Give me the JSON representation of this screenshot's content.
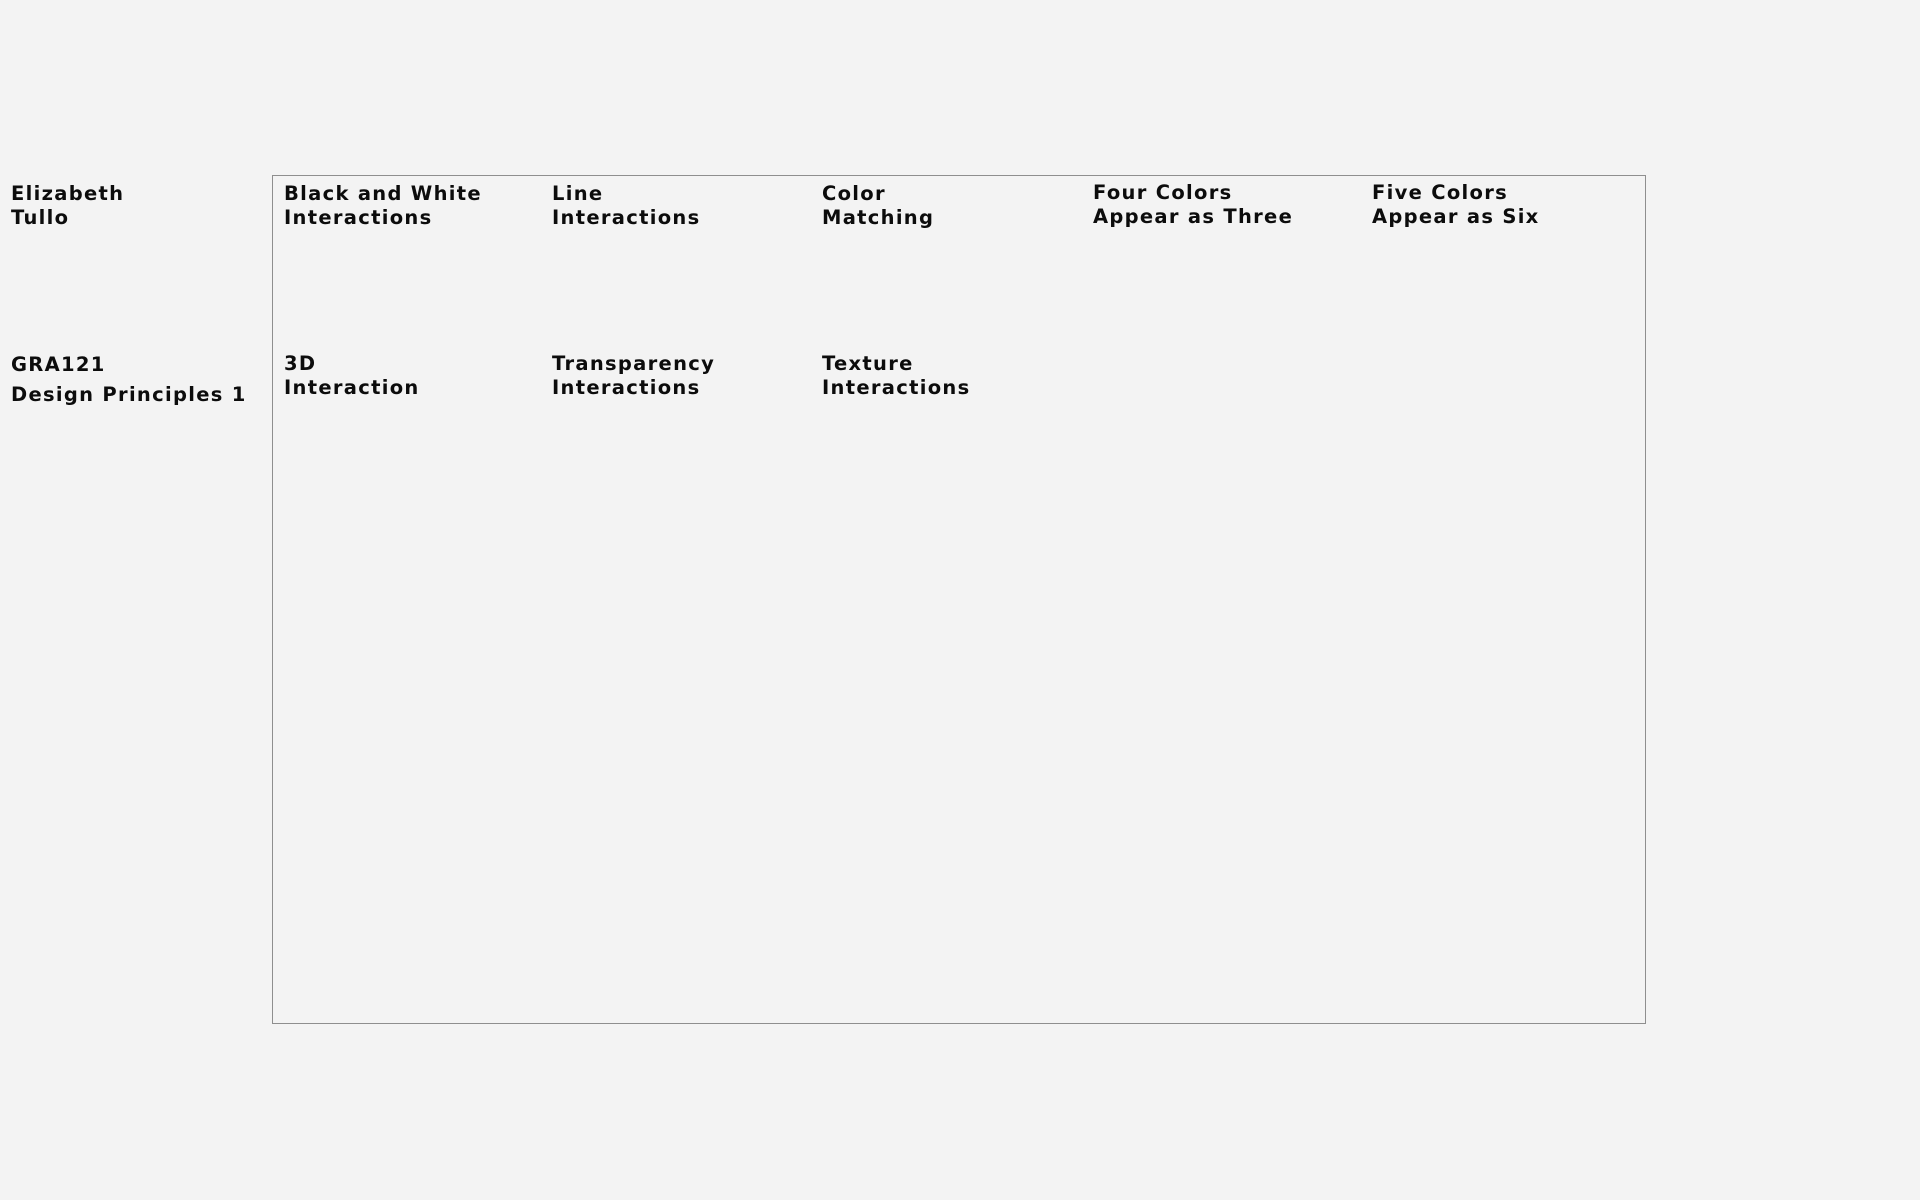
{
  "author": {
    "first_name": "Elizabeth",
    "last_name": "Tullo"
  },
  "course": {
    "code": "GRA121",
    "name": "Design Principles 1"
  },
  "projects": [
    {
      "line1": "Black and White",
      "line2": "Interactions"
    },
    {
      "line1": "Line",
      "line2": "Interactions"
    },
    {
      "line1": "Color",
      "line2": "Matching"
    },
    {
      "line1": "Four Colors",
      "line2": "Appear as Three"
    },
    {
      "line1": "Five Colors",
      "line2": "Appear as Six"
    },
    {
      "line1": "3D",
      "line2": "Interaction"
    },
    {
      "line1": "Transparency",
      "line2": "Interactions"
    },
    {
      "line1": "Texture",
      "line2": "Interactions"
    }
  ],
  "colors": {
    "background": "#f3f3f3",
    "text": "#0c0c0c",
    "frame_border": "#8e8e8e"
  }
}
